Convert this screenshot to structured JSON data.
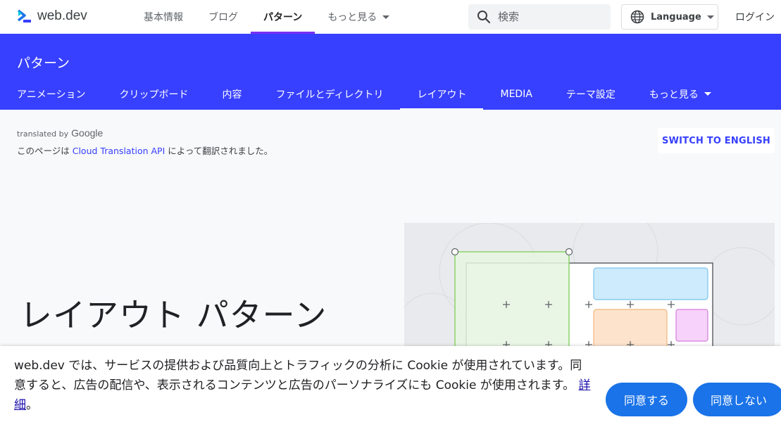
{
  "header": {
    "logo_text": "web.dev",
    "nav": [
      {
        "label": "基本情報",
        "active": false
      },
      {
        "label": "ブログ",
        "active": false
      },
      {
        "label": "パターン",
        "active": true
      },
      {
        "label": "もっと見る",
        "active": false
      }
    ],
    "search_placeholder": "検索",
    "language_label": "Language",
    "login_label": "ログイン"
  },
  "section": {
    "title": "パターン",
    "tabs": [
      {
        "label": "アニメーション"
      },
      {
        "label": "クリップボード"
      },
      {
        "label": "内容"
      },
      {
        "label": "ファイルとディレクトリ"
      },
      {
        "label": "レイアウト",
        "active": true
      },
      {
        "label": "MEDIA"
      },
      {
        "label": "テーマ設定"
      },
      {
        "label": "もっと見る"
      }
    ]
  },
  "translation": {
    "translated_by": "translated by",
    "google": "Google",
    "notice_before": "このページは ",
    "notice_link": "Cloud Translation API",
    "notice_after": " によって翻訳されました。",
    "switch_label": "SWITCH TO ENGLISH"
  },
  "hero": {
    "title": "レイアウト パターン"
  },
  "cookie": {
    "text": "web.dev では、サービスの提供および品質向上とトラフィックの分析に Cookie が使用されています。同意すると、広告の配信や、表示されるコンテンツと広告のパーソナライズにも Cookie が使用されます。",
    "link_label": "詳細",
    "trailing": "。",
    "agree_label": "同意する",
    "decline_label": "同意しない"
  },
  "colors": {
    "brand_blue": "#3740ff",
    "active_tab_underline": "#7a2ff3",
    "button_blue": "#1a73e8"
  }
}
